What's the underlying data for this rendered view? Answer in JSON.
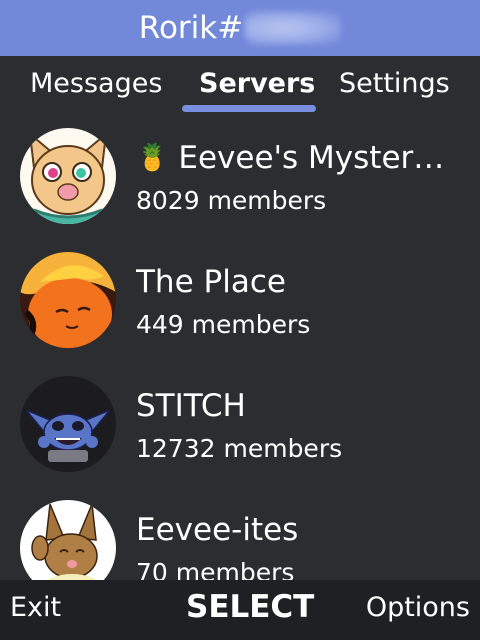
{
  "title": {
    "username": "Rorik#"
  },
  "tabs": [
    {
      "label": "Messages",
      "active": false
    },
    {
      "label": "Servers",
      "active": true
    },
    {
      "label": "Settings",
      "active": false
    }
  ],
  "servers": [
    {
      "name": "Eevee's Myster…",
      "members": "8029 members",
      "emoji_icon": "pineapple-icon",
      "avatar": "eevee-face-avatar"
    },
    {
      "name": "The Place",
      "members": "449 members",
      "avatar": "orange-fox-avatar"
    },
    {
      "name": "STITCH",
      "members": "12732 members",
      "avatar": "stitch-avatar"
    },
    {
      "name": "Eevee-ites",
      "members": "70 members",
      "avatar": "eevee-waving-avatar"
    }
  ],
  "softkeys": {
    "left": "Exit",
    "center": "SELECT",
    "right": "Options"
  },
  "colors": {
    "header": "#7289da",
    "background": "#2b2d31",
    "softkey_bar": "#1f2024",
    "tab_indicator": "#7a8ee0"
  }
}
